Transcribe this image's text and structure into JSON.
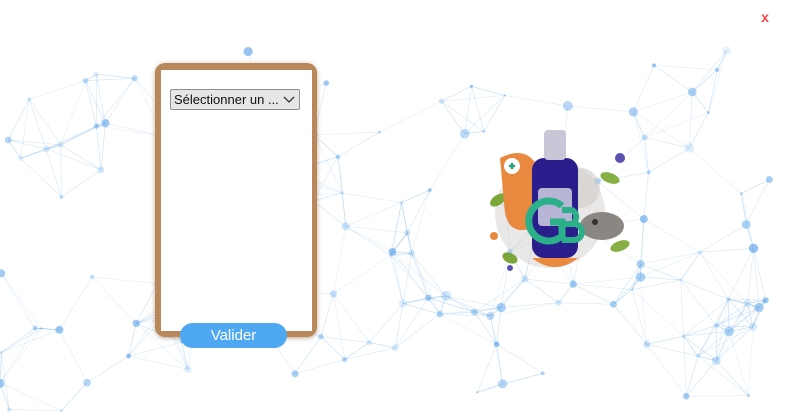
{
  "window": {
    "close_label": "x"
  },
  "form": {
    "select_value": "Sélectionner un ...",
    "validate_label": "Valider"
  },
  "logo": {
    "monogram": "GB"
  },
  "colors": {
    "accent": "#4ea8f2",
    "close": "#ef4b4b",
    "frame": "#b8875a",
    "network": "#5aa3e8"
  },
  "icons": [
    "chevron-down-icon",
    "network-background",
    "close-icon"
  ]
}
